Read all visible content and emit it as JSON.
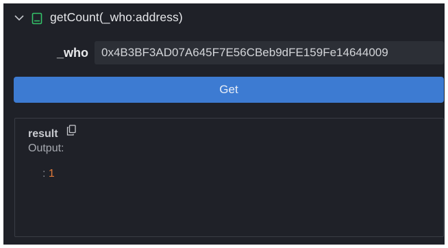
{
  "function": {
    "title": "getCount(_who:address)",
    "expand_icon": "chevron-down-icon",
    "type_icon": "function-icon"
  },
  "params": [
    {
      "label": "_who",
      "value": "0x4B3BF3AD07A645F7E56CBeb9dFE159Fe14644009"
    }
  ],
  "actions": {
    "get_label": "Get"
  },
  "result": {
    "label": "result",
    "copy_icon": "copy-icon",
    "output_label": "Output:",
    "separator": ":",
    "value": "1"
  },
  "colors": {
    "panel_bg": "#1f2128",
    "input_bg": "#2c2f36",
    "button_bg": "#3d7bd2",
    "value_color": "#e07a3a"
  }
}
